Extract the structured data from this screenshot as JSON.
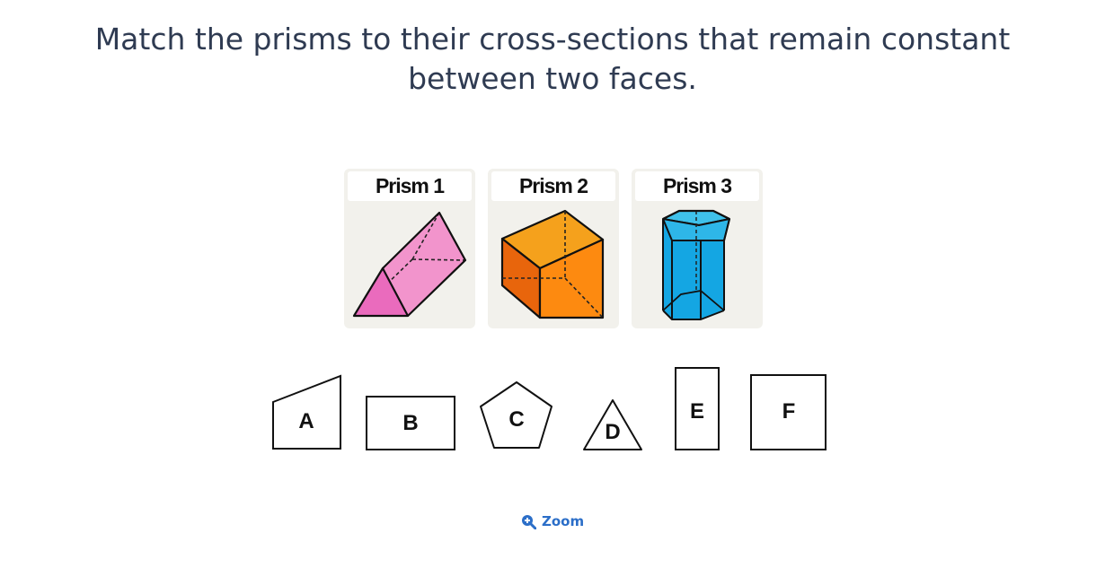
{
  "question": {
    "line1": "Match the prisms to their cross-sections that remain constant",
    "line2": "between two faces."
  },
  "prisms": [
    {
      "label": "Prism 1",
      "color": "#f08ccc",
      "shape": "triangular-prism"
    },
    {
      "label": "Prism 2",
      "color": "#f7921e",
      "shape": "rectangular-prism"
    },
    {
      "label": "Prism 3",
      "color": "#1ea9e1",
      "shape": "pentagonal-prism"
    }
  ],
  "cross_sections": [
    {
      "letter": "A",
      "shape": "trapezoid"
    },
    {
      "letter": "B",
      "shape": "rectangle"
    },
    {
      "letter": "C",
      "shape": "pentagon"
    },
    {
      "letter": "D",
      "shape": "triangle"
    },
    {
      "letter": "E",
      "shape": "tall-rectangle"
    },
    {
      "letter": "F",
      "shape": "square"
    }
  ],
  "zoom": {
    "label": "Zoom",
    "icon": "zoom-in-icon",
    "color": "#2b6ec8"
  }
}
